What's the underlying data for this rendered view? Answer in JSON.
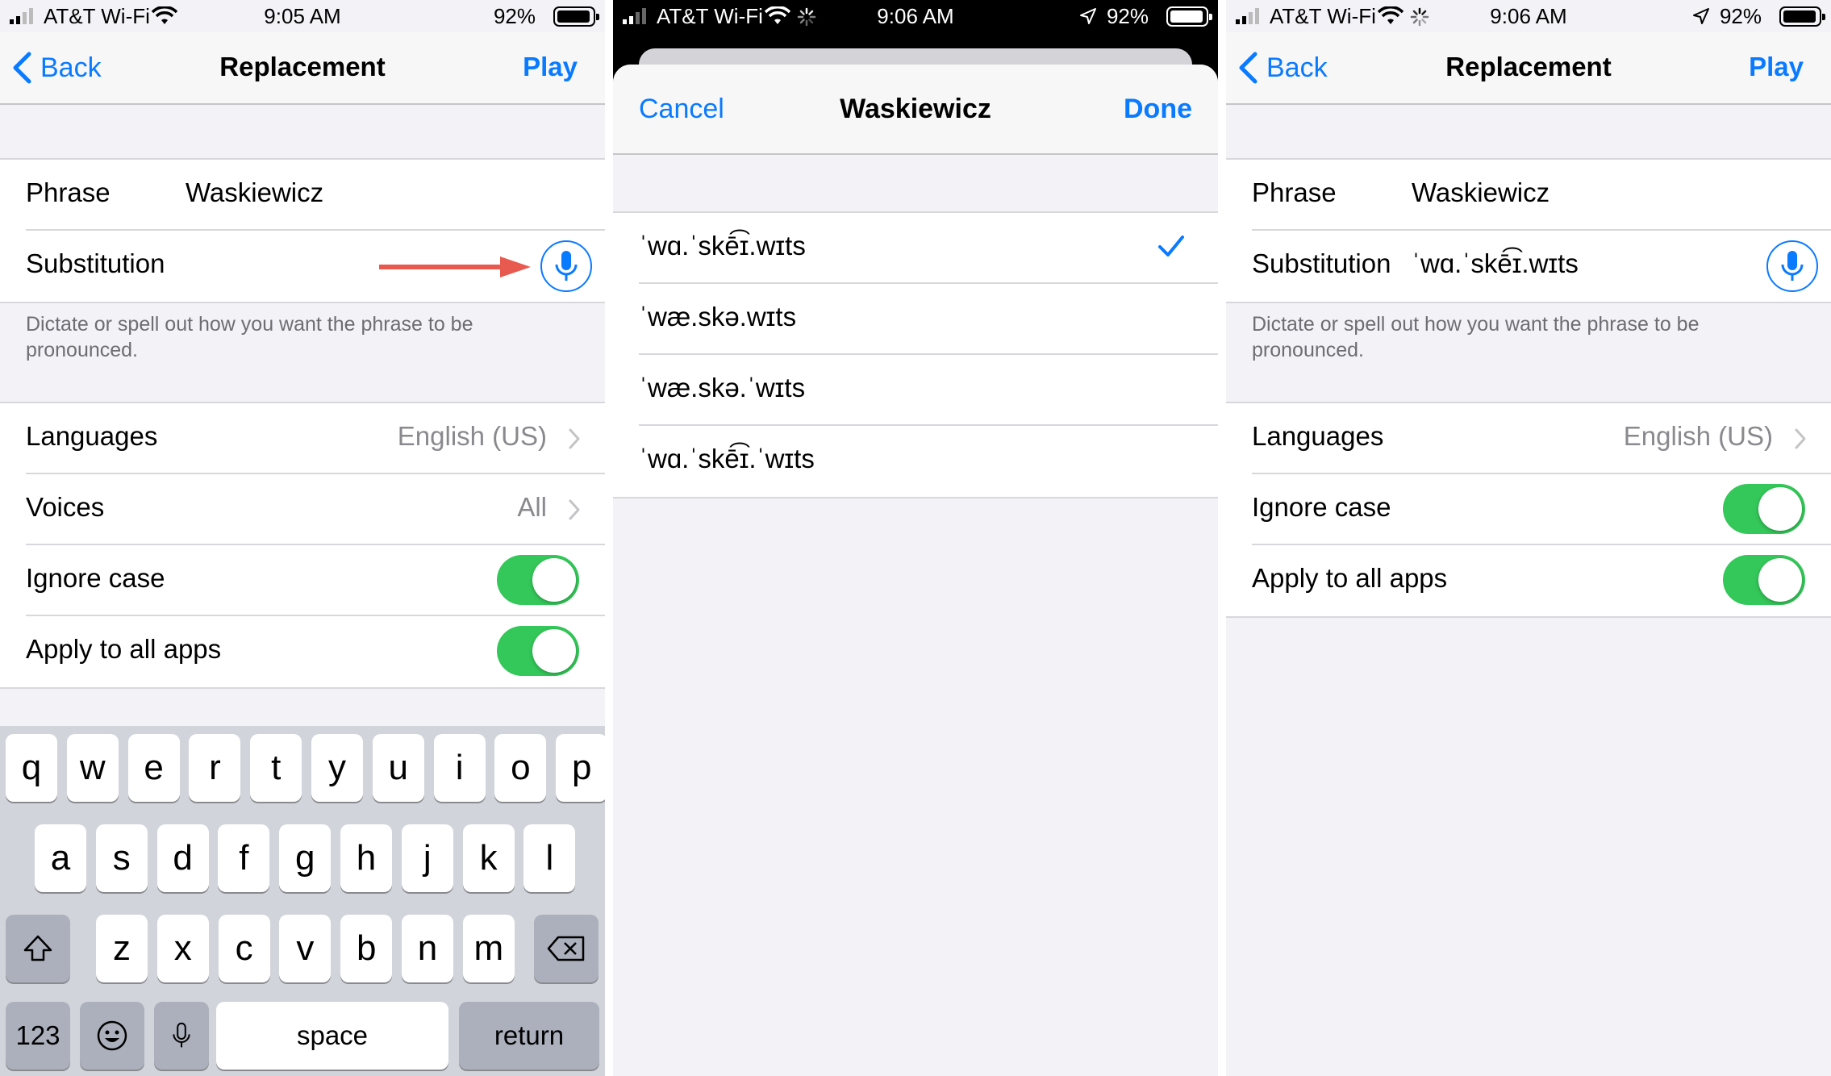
{
  "colors": {
    "accent": "#0a7aff",
    "toggle_on": "#34c759",
    "arrow": "#e85a4f"
  },
  "left": {
    "status": {
      "carrier": "AT&T Wi-Fi",
      "time": "9:05 AM",
      "battery": "92%"
    },
    "nav": {
      "back": "Back",
      "title": "Replacement",
      "play": "Play"
    },
    "phrase_label": "Phrase",
    "phrase_value": "Waskiewicz",
    "substitution_label": "Substitution",
    "substitution_value": "",
    "footer": "Dictate or spell out how you want the phrase to be pronounced.",
    "languages_label": "Languages",
    "languages_value": "English (US)",
    "voices_label": "Voices",
    "voices_value": "All",
    "ignore_case_label": "Ignore case",
    "ignore_case_on": true,
    "apply_all_label": "Apply to all apps",
    "apply_all_on": true,
    "keyboard": {
      "row1": [
        "q",
        "w",
        "e",
        "r",
        "t",
        "y",
        "u",
        "i",
        "o",
        "p"
      ],
      "row2": [
        "a",
        "s",
        "d",
        "f",
        "g",
        "h",
        "j",
        "k",
        "l"
      ],
      "row3": [
        "z",
        "x",
        "c",
        "v",
        "b",
        "n",
        "m"
      ],
      "numbers_key": "123",
      "space_key": "space",
      "return_key": "return"
    }
  },
  "middle": {
    "status": {
      "carrier": "AT&T Wi-Fi",
      "time": "9:06 AM",
      "battery": "92%"
    },
    "sheet": {
      "cancel": "Cancel",
      "title": "Waskiewicz",
      "done": "Done"
    },
    "options": [
      {
        "text": "ˈwɑ.ˈskē͡ɪ.wɪts",
        "selected": true
      },
      {
        "text": "ˈwæ.skə.wɪts",
        "selected": false
      },
      {
        "text": "ˈwæ.skə.ˈwɪts",
        "selected": false
      },
      {
        "text": "ˈwɑ.ˈskē͡ɪ.ˈwɪts",
        "selected": false
      }
    ]
  },
  "right": {
    "status": {
      "carrier": "AT&T Wi-Fi",
      "time": "9:06 AM",
      "battery": "92%"
    },
    "nav": {
      "back": "Back",
      "title": "Replacement",
      "play": "Play"
    },
    "phrase_label": "Phrase",
    "phrase_value": "Waskiewicz",
    "substitution_label": "Substitution",
    "substitution_value": "ˈwɑ.ˈskē͡ɪ.wɪts",
    "footer": "Dictate or spell out how you want the phrase to be pronounced.",
    "languages_label": "Languages",
    "languages_value": "English (US)",
    "ignore_case_label": "Ignore case",
    "ignore_case_on": true,
    "apply_all_label": "Apply to all apps",
    "apply_all_on": true
  }
}
